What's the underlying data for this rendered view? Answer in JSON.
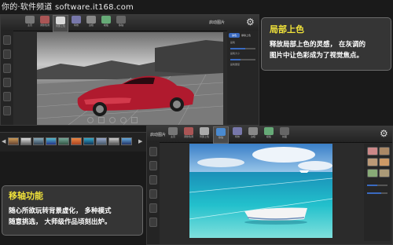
{
  "watermark": "你的·软件频道 software.it168.com",
  "top_app": {
    "window_title": "启动图片",
    "toolbar": [
      "主页",
      "调整色调",
      "局部上色",
      "特效",
      "边框",
      "模板",
      "移轴"
    ],
    "panel_tabs": [
      "涂色",
      "擦除上色"
    ],
    "panel_labels": [
      "画笔",
      "画笔大小",
      "画笔硬度"
    ]
  },
  "bottom_app": {
    "window_title": "启动图片",
    "toolbar": [
      "主页",
      "调整色调",
      "局部上色",
      "移轴",
      "特效",
      "边框",
      "模板",
      "拼图"
    ]
  },
  "callout_color": {
    "title": "局部上色",
    "line1": "释放局部上色的灵感，  在灰调的",
    "line2": "图片中让色彩成为了视觉焦点。"
  },
  "callout_tilt": {
    "title": "移轴功能",
    "line1": "随心所欲玩转背景虚化，  多种模式",
    "line2": "随意挑选，  大师级作品顷刻出炉。"
  },
  "colors": {
    "accent": "#f0e23a",
    "panel": "#2b2b2b",
    "car_red": "#b01a2e",
    "sea": "#1fb7c8"
  }
}
